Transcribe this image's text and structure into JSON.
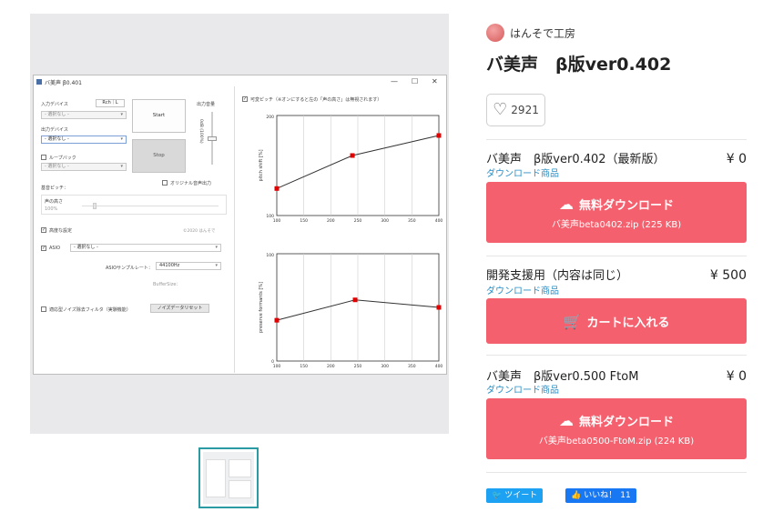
{
  "preview": {
    "app": {
      "title": "バ美声 β0.401",
      "win_controls": [
        "—",
        "☐",
        "✕"
      ],
      "input_device_label": "入力デバイス",
      "channel_toggle": "Rch｜L",
      "input_device_value": "- 選択なし -",
      "output_device_label": "出力デバイス",
      "output_device_value": "- 選択なし -",
      "loopback_label": "ループバック",
      "loopback_value": "- 選択なし -",
      "start_label": "Start",
      "stop_label": "Stop",
      "output_volume_label": "出力音量",
      "db_label": "0dB (100%)",
      "original_output_label": "オリジナル音声出力",
      "base_pitch_label": "基音ピッチ：",
      "voice_height_label": "声の高さ",
      "voice_height_value": "100%",
      "advanced_label": "高度な設定",
      "copyright": "©2020 はんそで",
      "asio_label": "ASIO",
      "asio_value": "- 選択なし -",
      "asio_rate_label": "ASIOサンプルレート：",
      "asio_rate_value": "44100Hz",
      "buffer_label": "BufferSize：",
      "noise_label": "適応型ノイズ除去フィルタ（実験機能）",
      "noise_reset_label": "ノイズデータリセット",
      "variable_pitch_label": "可変ピッチ（※オンにすると左の「声の高さ」は無視されます）",
      "chart1_ylabel": "pitch shift [%]",
      "chart2_ylabel": "preserve formants [%]",
      "chart1_yticks": [
        "200",
        "100"
      ],
      "chart2_yticks": [
        "100",
        "0"
      ],
      "xticks": [
        "100",
        "150",
        "200",
        "250",
        "300",
        "350",
        "400"
      ]
    }
  },
  "chart_data": [
    {
      "type": "line",
      "ylabel": "pitch shift [%]",
      "xlim": [
        100,
        400
      ],
      "ylim": [
        100,
        200
      ],
      "x": [
        100,
        240,
        400
      ],
      "values": [
        127,
        160,
        180
      ]
    },
    {
      "type": "line",
      "ylabel": "preserve formants [%]",
      "xlim": [
        100,
        400
      ],
      "ylim": [
        0,
        100
      ],
      "x": [
        100,
        245,
        400
      ],
      "values": [
        38,
        57,
        50
      ]
    }
  ],
  "creator": {
    "name": "はんそで工房"
  },
  "title": "バ美声　β版ver0.402",
  "likes": "2921",
  "items": [
    {
      "name": "バ美声　β版ver0.402（最新版）",
      "price": "¥ 0",
      "type": "ダウンロード商品",
      "cta": "無料ダウンロード",
      "file": "バ美声beta0402.zip (225 KB)"
    },
    {
      "name": "開発支援用（内容は同じ）",
      "price": "¥ 500",
      "type": "ダウンロード商品",
      "cta": "カートに入れる"
    },
    {
      "name": "バ美声　β版ver0.500 FtoM",
      "price": "¥ 0",
      "type": "ダウンロード商品",
      "cta": "無料ダウンロード",
      "file": "バ美声beta0500-FtoM.zip (224 KB)"
    }
  ],
  "share": {
    "tweet": "ツイート",
    "like": "いいね！",
    "like_count": "11"
  },
  "colors": {
    "accent": "#f4606d",
    "link": "#2a8fc6",
    "thumb_border": "#2a9ba3"
  }
}
